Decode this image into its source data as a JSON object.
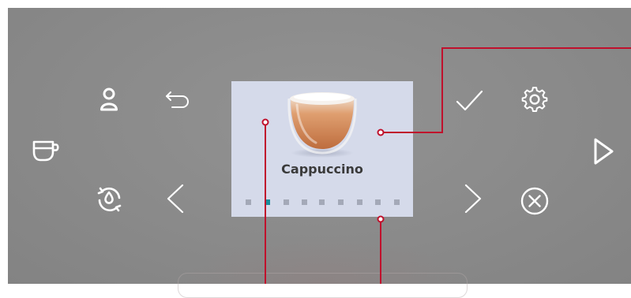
{
  "screen": {
    "beverage_name": "Cappuccino",
    "pager": {
      "total": 9,
      "active_index": 1
    }
  },
  "icons": {
    "profile": "person-icon",
    "back": "return-arrow-icon",
    "confirm": "checkmark-icon",
    "settings": "gear-icon",
    "cup": "cup-icon",
    "maintenance": "rinse-cycle-icon",
    "prev": "chevron-left-icon",
    "next": "chevron-right-icon",
    "cancel": "cancel-circle-icon",
    "start": "play-triangle-icon"
  },
  "colors": {
    "panel": "#8a8a8a",
    "icon": "#ffffff",
    "screen": "#d5daea",
    "accent_dot": "#1b8e9c",
    "callout": "#c0102c"
  }
}
